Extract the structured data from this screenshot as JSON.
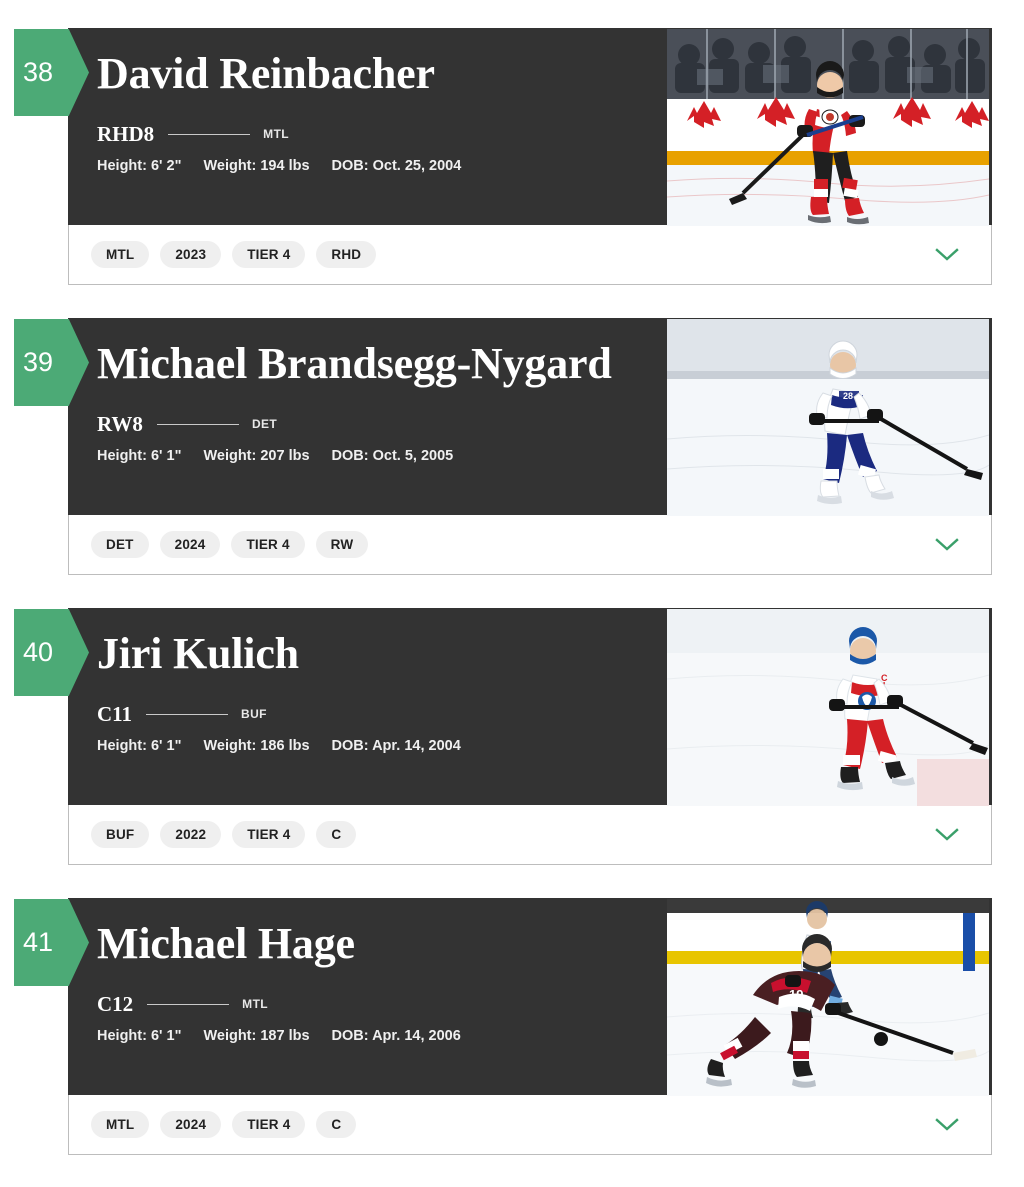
{
  "theme": {
    "accent_green": "#4CAA76",
    "panel_dark": "#333333",
    "chip_bg": "#efefef",
    "card_border": "#bdbdbd",
    "name_color": "#ffffff"
  },
  "labels": {
    "height_prefix": "Height:",
    "weight_prefix": "Weight:",
    "dob_prefix": "DOB:",
    "expand_icon": "chevron-down-icon"
  },
  "players": [
    {
      "rank": "38",
      "name": "David Reinbacher",
      "position_code": "RHD8",
      "team_abbr": "MTL",
      "height": "Height: 6' 2\"",
      "weight": "Weight: 194 lbs",
      "dob": "DOB: Oct. 25, 2004",
      "chips": [
        "MTL",
        "2023",
        "TIER 4",
        "RHD"
      ],
      "photo_alt": "player-photo-david-reinbacher",
      "photo": {
        "scene": "austria-red-white-jersey-on-ice",
        "jersey_primary": "#d42026",
        "jersey_secondary": "#ffffff",
        "boards": "#ffffff",
        "kickplate": "#e8a100",
        "crowd": "#4a4f58",
        "ice": "#f2f5f7",
        "logo": "maple-leaf",
        "logo_color": "#d42026"
      }
    },
    {
      "rank": "39",
      "name": "Michael Brandsegg-Nygard",
      "position_code": "RW8",
      "team_abbr": "DET",
      "height": "Height: 6' 1\"",
      "weight": "Weight: 207 lbs",
      "dob": "DOB: Oct. 5, 2005",
      "chips": [
        "DET",
        "2024",
        "TIER 4",
        "RW"
      ],
      "photo_alt": "player-photo-michael-brandsegg-nygard",
      "photo": {
        "scene": "norway-white-blue-jersey-skating",
        "jersey_primary": "#ffffff",
        "jersey_secondary": "#1b2a80",
        "boards": "#ffffff",
        "kickplate": "#ffffff",
        "crowd": "#dfe4ea",
        "ice": "#f4f7fa",
        "logo": "number-28",
        "logo_color": "#1b2a80"
      }
    },
    {
      "rank": "40",
      "name": "Jiri Kulich",
      "position_code": "C11",
      "team_abbr": "BUF",
      "height": "Height: 6' 1\"",
      "weight": "Weight: 186 lbs",
      "dob": "DOB: Apr. 14, 2004",
      "chips": [
        "BUF",
        "2022",
        "TIER 4",
        "C"
      ],
      "photo_alt": "player-photo-jiri-kulich",
      "photo": {
        "scene": "czechia-white-red-jersey-on-ice",
        "jersey_primary": "#ffffff",
        "jersey_secondary": "#d42026",
        "boards": "#ffffff",
        "kickplate": "#f0f0f0",
        "crowd": "#eef2f5",
        "ice": "#f6f8fa",
        "logo": "czech-lion",
        "logo_color": "#1b58a8"
      }
    },
    {
      "rank": "41",
      "name": "Michael Hage",
      "position_code": "C12",
      "team_abbr": "MTL",
      "height": "Height: 6' 1\"",
      "weight": "Weight: 187 lbs",
      "dob": "DOB: Apr. 14, 2006",
      "chips": [
        "MTL",
        "2024",
        "TIER 4",
        "C"
      ],
      "photo_alt": "player-photo-michael-hage",
      "photo": {
        "scene": "chicago-steel-maroon-jersey-rushing-puck",
        "jersey_primary": "#4a1f22",
        "jersey_secondary": "#c8102e",
        "boards": "#ffffff",
        "kickplate": "#e8c500",
        "crowd": "#ffffff",
        "ice": "#f7f9fb",
        "logo": "number-19",
        "logo_color": "#ffffff"
      }
    }
  ]
}
